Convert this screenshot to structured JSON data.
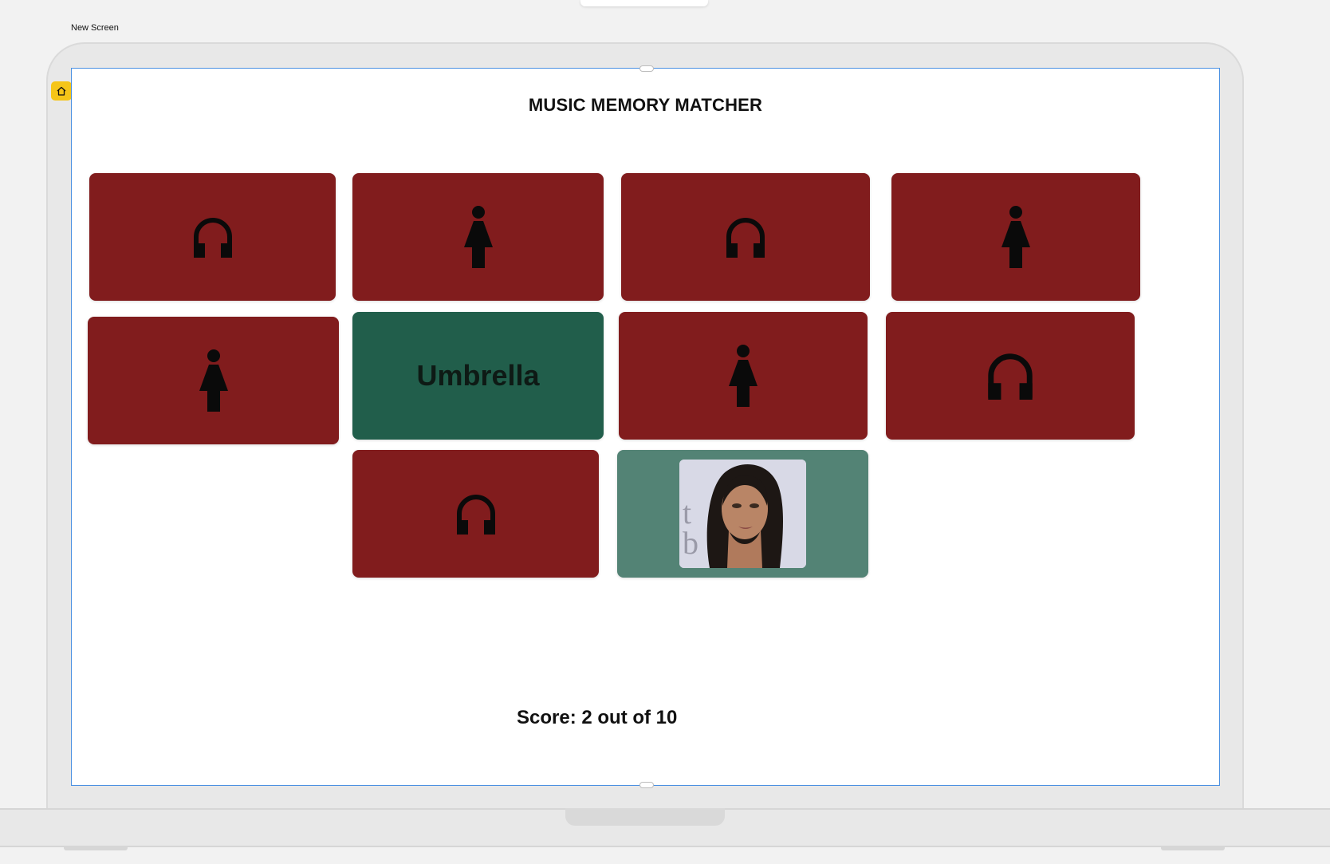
{
  "canvas": {
    "screen_label": "New Screen"
  },
  "app": {
    "title": "MUSIC MEMORY MATCHER",
    "score_text": "Score: 2 out of 10"
  },
  "cards": [
    {
      "state": "hidden",
      "icon": "headphones-icon"
    },
    {
      "state": "hidden",
      "icon": "person-icon"
    },
    {
      "state": "hidden",
      "icon": "headphones-icon"
    },
    {
      "state": "hidden",
      "icon": "person-icon"
    },
    {
      "state": "hidden",
      "icon": "person-icon"
    },
    {
      "state": "revealed",
      "text": "Umbrella"
    },
    {
      "state": "hidden",
      "icon": "person-icon"
    },
    {
      "state": "hidden",
      "icon": "headphones-icon"
    },
    {
      "state": "hidden",
      "icon": "headphones-icon"
    },
    {
      "state": "revealed",
      "image": "artist-photo"
    }
  ],
  "colors": {
    "card_hidden": "#811c1d",
    "card_revealed_text": "#215e4b",
    "card_revealed_image": "#538375",
    "selection_outline": "#4a90e2",
    "home_badge": "#f5c518"
  }
}
